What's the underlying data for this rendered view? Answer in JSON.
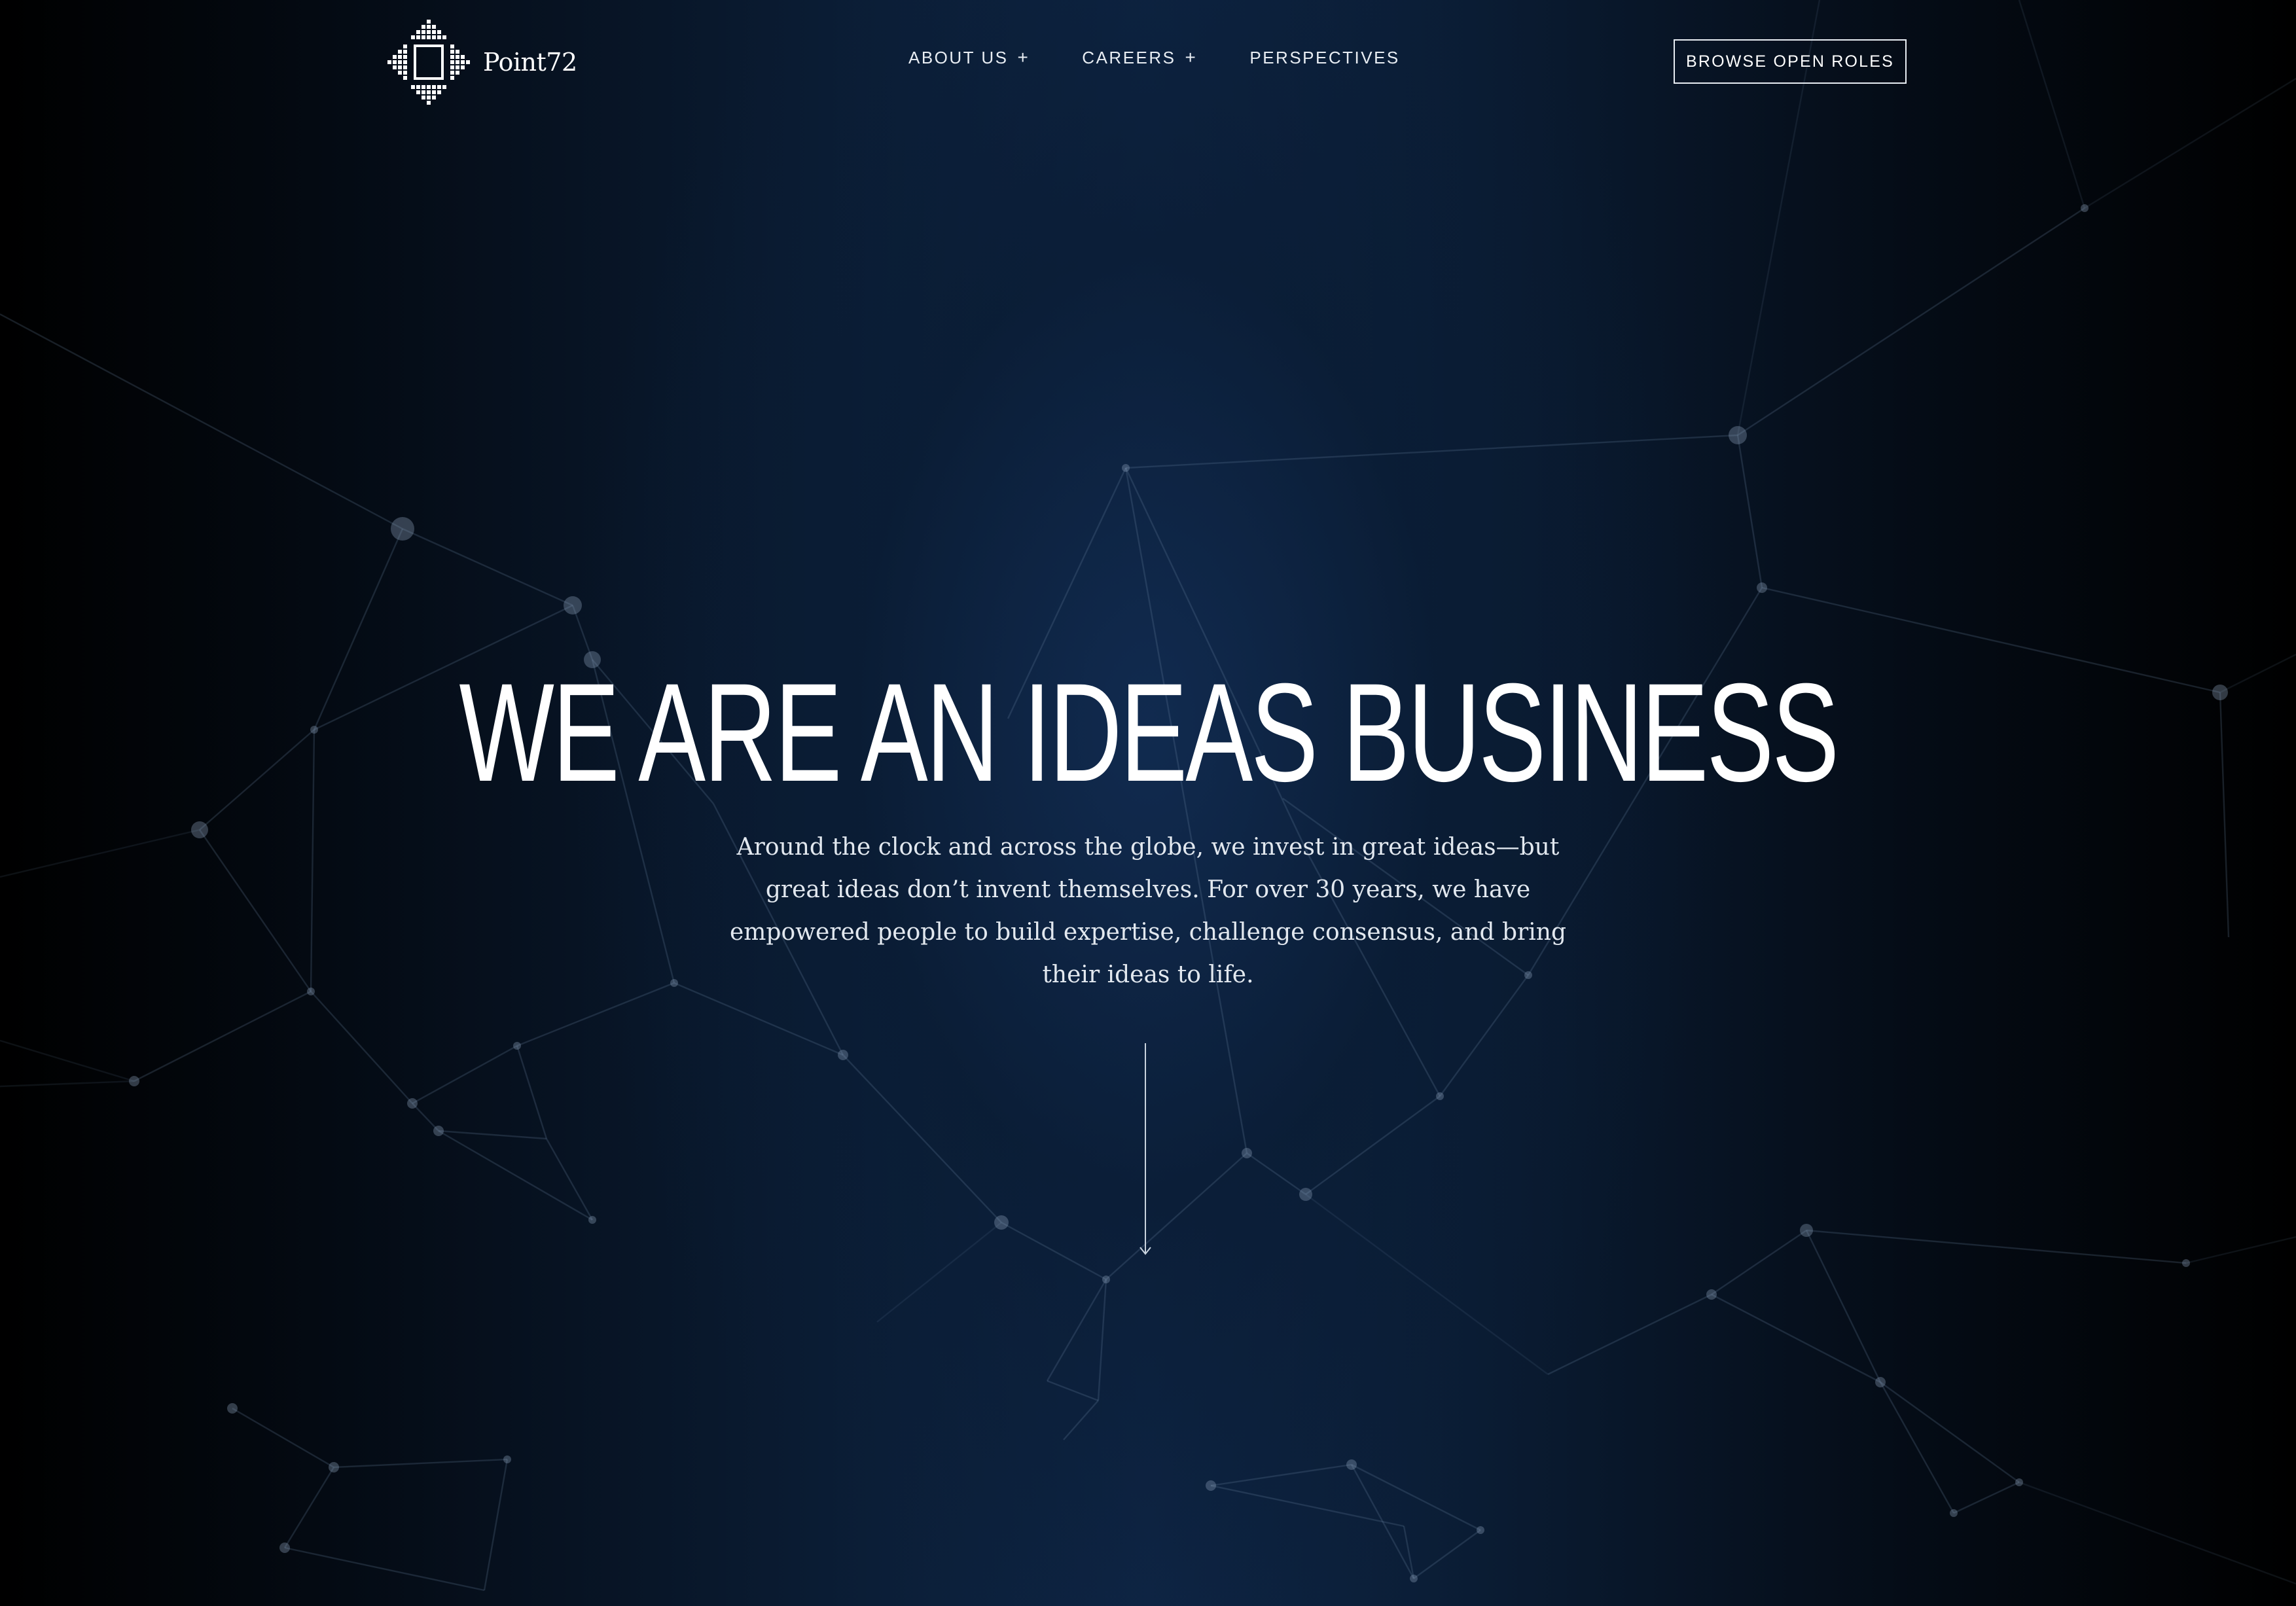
{
  "brand": {
    "name": "Point72"
  },
  "nav": {
    "items": [
      {
        "label": "ABOUT US",
        "has_submenu": true,
        "indicator": "+"
      },
      {
        "label": "CAREERS",
        "has_submenu": true,
        "indicator": "+"
      },
      {
        "label": "PERSPECTIVES",
        "has_submenu": false,
        "indicator": ""
      }
    ],
    "cta_label": "BROWSE OPEN ROLES"
  },
  "hero": {
    "title": "WE ARE AN IDEAS BUSINESS",
    "subtitle": "Around the clock and across the globe, we invest in great ideas—but great ideas don’t invent themselves. For over 30 years, we have empowered people to build expertise, challenge consensus, and bring their ideas to life.",
    "scroll_icon": "arrow-down-icon"
  },
  "colors": {
    "background_dark": "#03080f",
    "background_center": "#0e2545",
    "text": "#ffffff",
    "network_lines": "#6f8aa8"
  }
}
